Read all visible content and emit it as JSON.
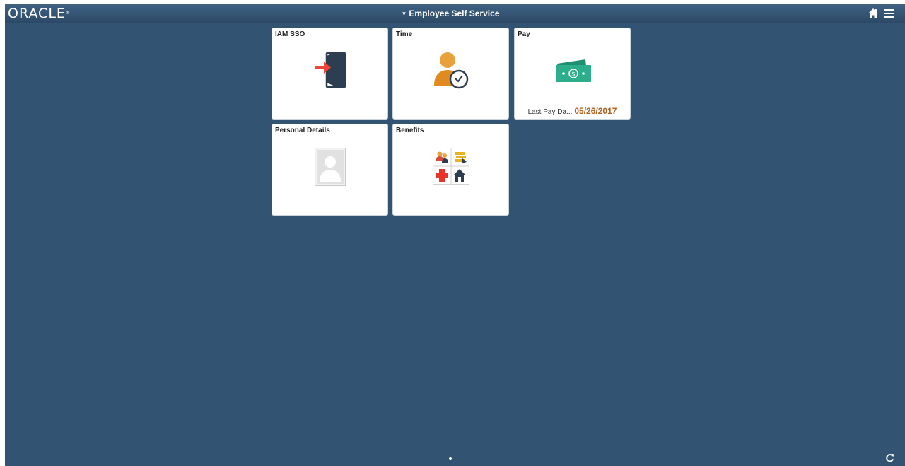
{
  "header": {
    "logo_text": "ORACLE",
    "logo_mark": "®",
    "title_caret": "▼",
    "title": "Employee Self Service",
    "actions": [
      {
        "name": "home",
        "icon": "home-icon"
      },
      {
        "name": "navbar",
        "icon": "hamburger-menu-icon"
      }
    ]
  },
  "tiles": {
    "iam_sso": {
      "title": "IAM SSO",
      "icon": "sign-in-door-icon"
    },
    "time": {
      "title": "Time",
      "icon": "person-clock-icon"
    },
    "pay": {
      "title": "Pay",
      "icon": "money-bills-icon",
      "last_pay_label": "Last Pay Da...",
      "last_pay_date": "05/26/2017"
    },
    "personal_details": {
      "title": "Personal Details",
      "icon": "person-placeholder-icon"
    },
    "benefits": {
      "title": "Benefits",
      "icon": "benefits-grid-icon"
    }
  },
  "footer": {
    "page_indicator_current": 1,
    "page_indicator_total": 1,
    "refresh_icon": "refresh-icon"
  },
  "colors": {
    "background": "#325372",
    "banner": "#2f4f6e",
    "pay_date": "#b45f1c",
    "arrow": "#e8473a",
    "door": "#2c3e50",
    "person": "#e9a13b",
    "money": "#2cae8c"
  }
}
